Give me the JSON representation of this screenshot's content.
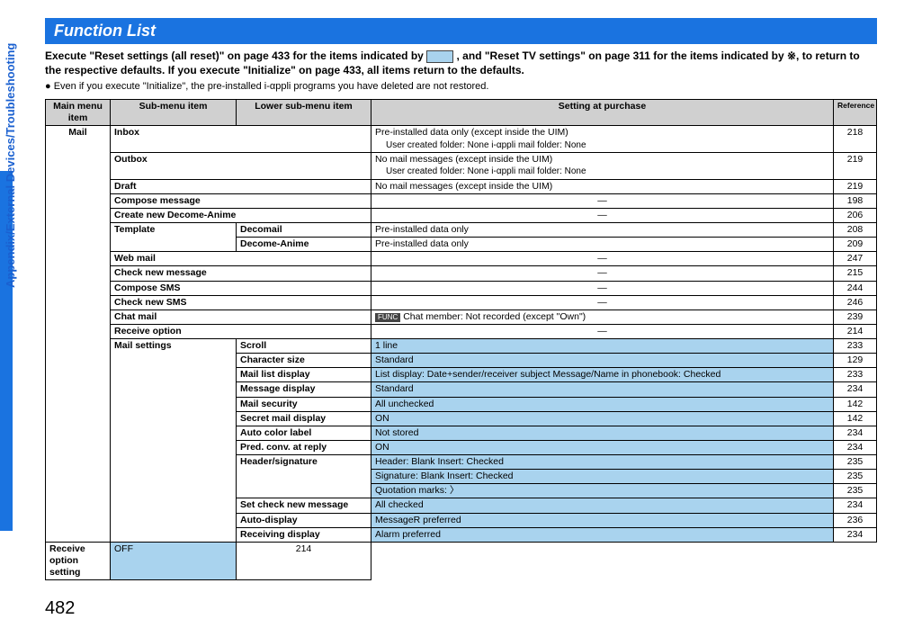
{
  "side_label": "Appendix/External Devices/Troubleshooting",
  "page_number": "482",
  "title": "Function List",
  "intro_bold_1": "Execute \"Reset settings (all reset)\" on page 433 for the items indicated by ",
  "intro_bold_2": " , and \"Reset TV settings\" on page 311 for the items indicated by ※, to return to the respective defaults. If you execute \"Initialize\" on page 433, all items return to the defaults.",
  "intro_note": "● Even if you execute \"Initialize\", the pre-installed i-αppli programs you have deleted are not restored.",
  "headers": {
    "main": "Main menu item",
    "sub": "Sub-menu item",
    "low": "Lower sub-menu item",
    "setting": "Setting at purchase",
    "ref": "Reference"
  },
  "main_item": "Mail",
  "rows": {
    "inbox_sub": "Inbox",
    "inbox_set": "Pre-installed data only (except inside the UIM)",
    "inbox_sub2": "User created folder: None                      i-αppli mail folder: None",
    "inbox_ref": "218",
    "outbox_sub": "Outbox",
    "outbox_set": "No mail messages (except inside the UIM)",
    "outbox_sub2": "User created folder: None                      i-αppli mail folder: None",
    "outbox_ref": "219",
    "draft_sub": "Draft",
    "draft_set": "No mail messages (except inside the UIM)",
    "draft_ref": "219",
    "compose_sub": "Compose message",
    "compose_set": "―",
    "compose_ref": "198",
    "decome_sub": "Create new Decome-Anime",
    "decome_set": "―",
    "decome_ref": "206",
    "template_sub": "Template",
    "decomail_low": "Decomail",
    "decomail_set": "Pre-installed data only",
    "decomail_ref": "208",
    "decomeA_low": "Decome-Anime",
    "decomeA_set": "Pre-installed data only",
    "decomeA_ref": "209",
    "web_sub": "Web mail",
    "web_set": "―",
    "web_ref": "247",
    "checknew_sub": "Check new message",
    "checknew_set": "―",
    "checknew_ref": "215",
    "sms_sub": "Compose SMS",
    "sms_set": "―",
    "sms_ref": "244",
    "checksms_sub": "Check new SMS",
    "checksms_set": "―",
    "checksms_ref": "246",
    "chat_sub": "Chat mail",
    "chat_set": "Chat member: Not recorded (except \"Own\")",
    "chat_ref": "239",
    "recv_sub": "Receive option",
    "recv_set": "―",
    "recv_ref": "214",
    "mailset_sub": "Mail settings",
    "scroll_low": "Scroll",
    "scroll_set": "1 line",
    "scroll_ref": "233",
    "char_low": "Character size",
    "char_set": "Standard",
    "char_ref": "129",
    "mld_low": "Mail list display",
    "mld_set": "List display: Date+sender/receiver subject            Message/Name in phonebook: Checked",
    "mld_ref": "233",
    "msgd_low": "Message display",
    "msgd_set": "Standard",
    "msgd_ref": "234",
    "msec_low": "Mail security",
    "msec_set": "All unchecked",
    "msec_ref": "142",
    "smd_low": "Secret mail display",
    "smd_set": "ON",
    "smd_ref": "142",
    "acl_low": "Auto color label",
    "acl_set": "Not stored",
    "acl_ref": "234",
    "pred_low": "Pred. conv. at reply",
    "pred_set": "ON",
    "pred_ref": "234",
    "hs_low": "Header/signature",
    "hs1_set": "Header: Blank                  Insert: Checked",
    "hs1_ref": "235",
    "hs2_set": "Signature: Blank              Insert: Checked",
    "hs2_ref": "235",
    "hs3_set": "Quotation marks: 〉",
    "hs3_ref": "235",
    "scnm_low": "Set check new message",
    "scnm_set": "All checked",
    "scnm_ref": "234",
    "adisp_low": "Auto-display",
    "adisp_set": "MessageR preferred",
    "adisp_ref": "236",
    "rdisp_low": "Receiving display",
    "rdisp_set": "Alarm preferred",
    "rdisp_ref": "234",
    "ros_low": "Receive option setting",
    "ros_set": "OFF",
    "ros_ref": "214"
  },
  "func_badge": "FUNC"
}
